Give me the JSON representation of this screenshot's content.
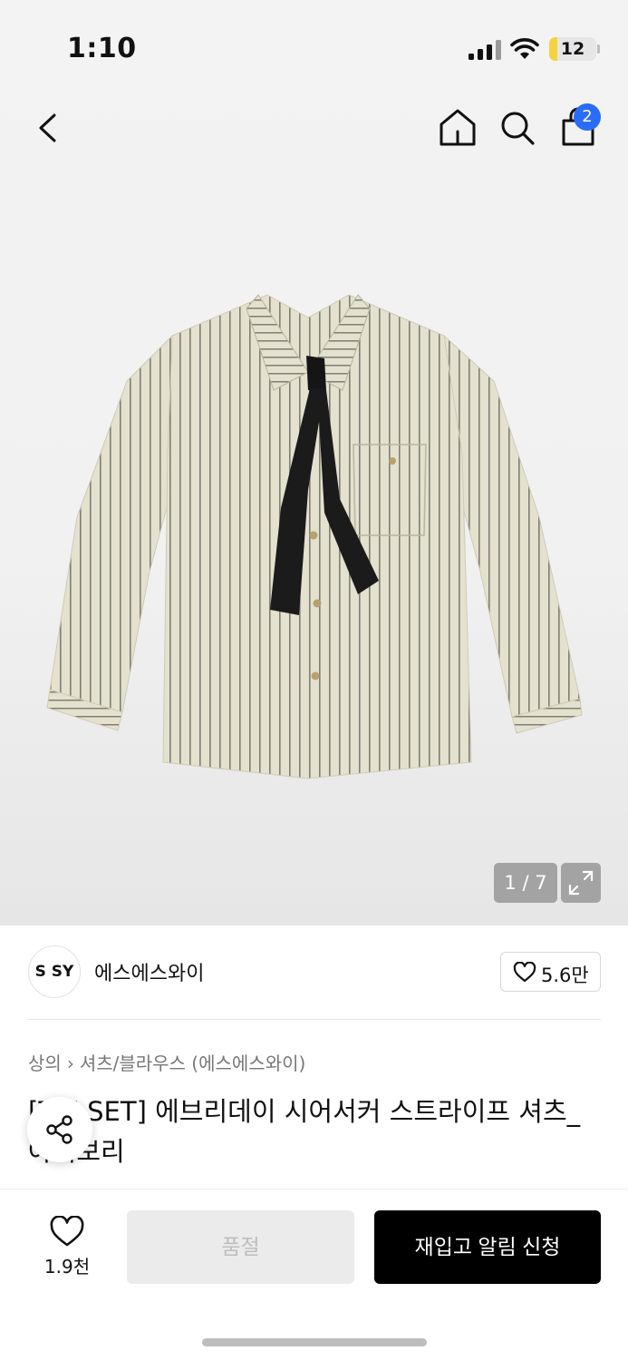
{
  "status_bar": {
    "time": "1:10",
    "battery_level": "12",
    "battery_color": "#f5d33f"
  },
  "nav": {
    "cart_count": "2"
  },
  "gallery": {
    "counter": "1 / 7",
    "current": 1,
    "total": 7
  },
  "brand": {
    "logo_text": "S SY",
    "name": "에스에스와이",
    "likes": "5.6만"
  },
  "breadcrumb": {
    "level1": "상의",
    "level2": "셔츠/블라우스 (에스에스와이)"
  },
  "product": {
    "title": "[TIE SET] 에브리데이 시어서커 스트라이프 셔츠_아이보리"
  },
  "action_bar": {
    "wish_count": "1.9천",
    "soldout_label": "품절",
    "restock_label": "재입고 알림 신청"
  },
  "colors": {
    "accent_badge": "#2a6cf5",
    "primary_button": "#000000",
    "disabled_button": "#ebebeb"
  }
}
